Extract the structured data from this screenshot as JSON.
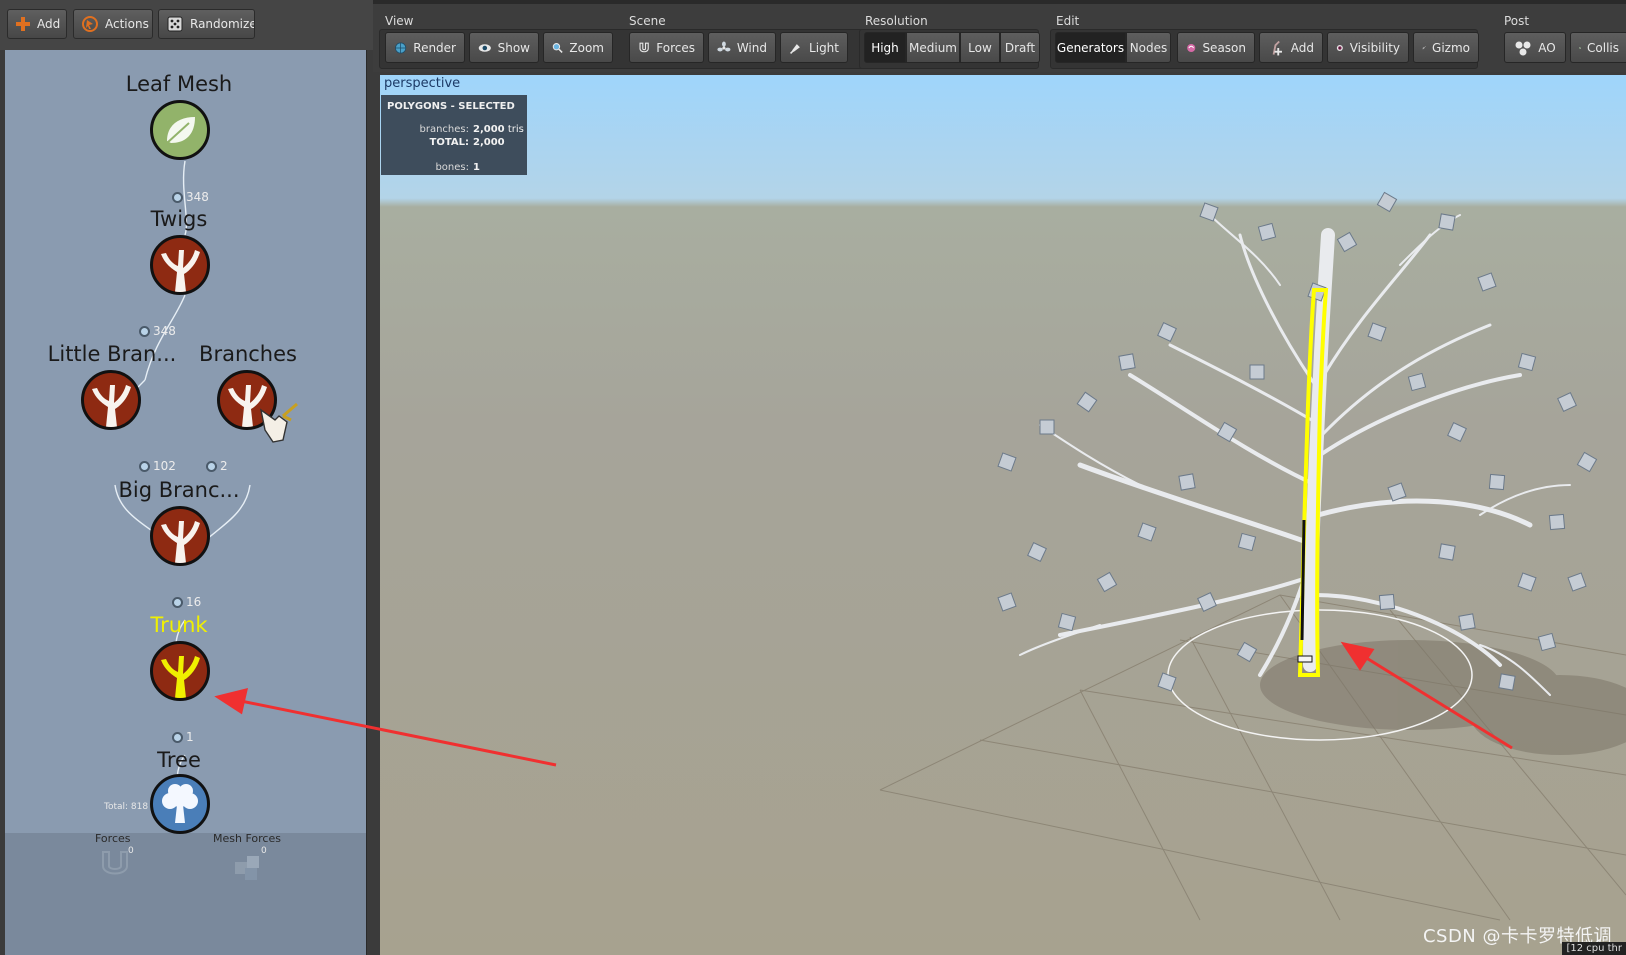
{
  "left_toolbar": {
    "add_label": "Add",
    "actions_label": "Actions",
    "randomize_label": "Randomize"
  },
  "nodes": {
    "leaf_mesh": "Leaf Mesh",
    "twigs": "Twigs",
    "little_branches": "Little Bran...",
    "branches": "Branches",
    "big_branches": "Big Branc...",
    "trunk": "Trunk",
    "tree": "Tree"
  },
  "connections": {
    "leaf_to_twigs": "348",
    "twigs_to_little": "348",
    "little_to_big": "102",
    "branches_to_big": "2",
    "big_to_trunk": "16",
    "trunk_to_tree": "1"
  },
  "panel_footer": {
    "total": "Total: 818",
    "forces_label": "Forces",
    "forces_count": "0",
    "mesh_forces_label": "Mesh Forces",
    "mesh_forces_count": "0"
  },
  "toolbar": {
    "view": {
      "label": "View",
      "render": "Render",
      "show": "Show",
      "zoom": "Zoom"
    },
    "scene": {
      "label": "Scene",
      "forces": "Forces",
      "wind": "Wind",
      "light": "Light"
    },
    "resolution": {
      "label": "Resolution",
      "high": "High",
      "medium": "Medium",
      "low": "Low",
      "draft": "Draft",
      "selected": "High"
    },
    "edit": {
      "label": "Edit",
      "generators": "Generators",
      "nodes": "Nodes",
      "season": "Season",
      "add": "Add",
      "visibility": "Visibility",
      "gizmo": "Gizmo",
      "selected": "Generators"
    },
    "post": {
      "label": "Post",
      "ao": "AO",
      "collision": "Collis"
    }
  },
  "viewport": {
    "camera_label": "perspective",
    "stats_title": "POLYGONS - SELECTED",
    "branches_label": "branches:",
    "branches_value": "2,000",
    "branches_unit": "tris",
    "total_label": "TOTAL:",
    "total_value": "2,000",
    "bones_label": "bones:",
    "bones_value": "1",
    "cpu_text": "[12 cpu thr"
  },
  "watermark": "CSDN @卡卡罗特低调",
  "colors": {
    "panel_bg": "#8a9bb0",
    "node_red": "#8e2a12",
    "node_selected": "#f0f000",
    "highlight_outline": "#ffff00",
    "arrow": "#f03030"
  }
}
